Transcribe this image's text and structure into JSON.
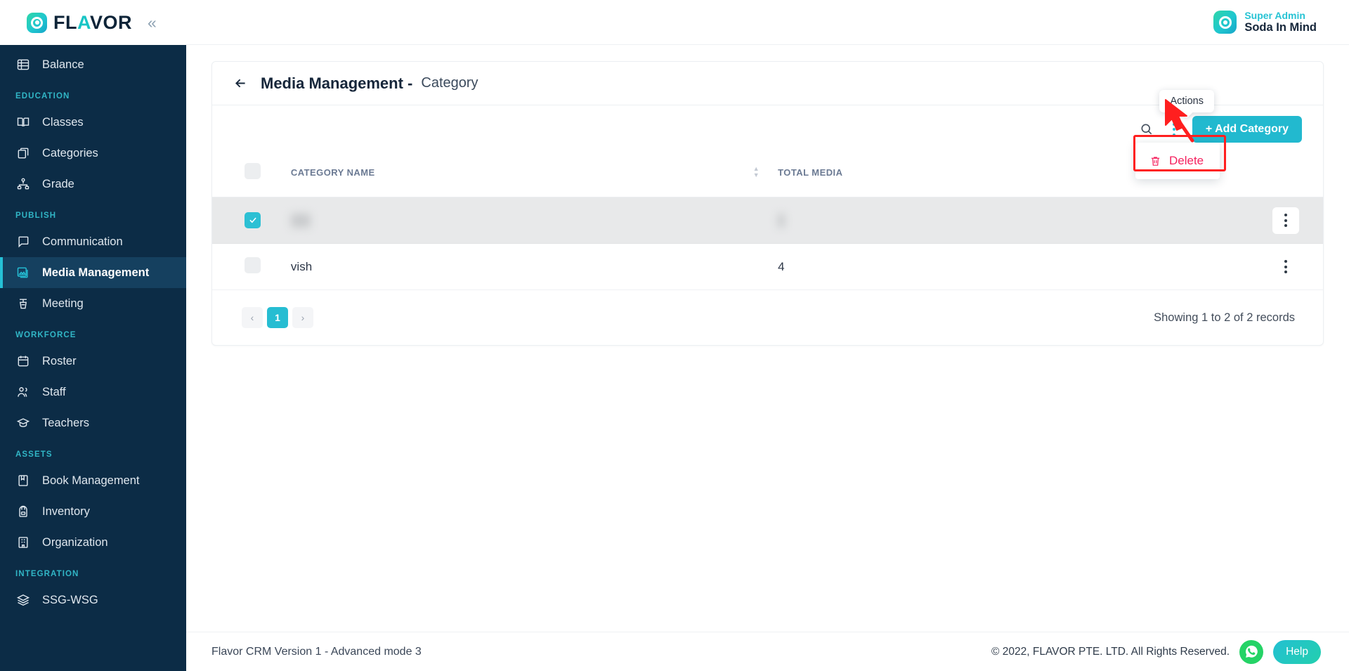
{
  "brand": {
    "name_main": "FL",
    "name_accent": "A",
    "name_rest": "VOR",
    "full": "FLAVOR",
    "collapse_glyph": "«"
  },
  "sidebar": {
    "groups": [
      {
        "label": "",
        "items": [
          {
            "label": "Balance",
            "icon": "balance-icon",
            "active": false
          }
        ]
      },
      {
        "label": "EDUCATION",
        "items": [
          {
            "label": "Classes",
            "icon": "book-icon",
            "active": false
          },
          {
            "label": "Categories",
            "icon": "categories-icon",
            "active": false
          },
          {
            "label": "Grade",
            "icon": "grade-icon",
            "active": false
          }
        ]
      },
      {
        "label": "PUBLISH",
        "items": [
          {
            "label": "Communication",
            "icon": "chat-icon",
            "active": false
          },
          {
            "label": "Media Management",
            "icon": "media-icon",
            "active": true
          },
          {
            "label": "Meeting",
            "icon": "podium-icon",
            "active": false
          }
        ]
      },
      {
        "label": "WORKFORCE",
        "items": [
          {
            "label": "Roster",
            "icon": "calendar-icon",
            "active": false
          },
          {
            "label": "Staff",
            "icon": "users-icon",
            "active": false
          },
          {
            "label": "Teachers",
            "icon": "graduation-cap-icon",
            "active": false
          }
        ]
      },
      {
        "label": "ASSETS",
        "items": [
          {
            "label": "Book Management",
            "icon": "book-closed-icon",
            "active": false
          },
          {
            "label": "Inventory",
            "icon": "backpack-icon",
            "active": false
          },
          {
            "label": "Organization",
            "icon": "building-icon",
            "active": false
          }
        ]
      },
      {
        "label": "INTEGRATION",
        "items": [
          {
            "label": "SSG-WSG",
            "icon": "layers-icon",
            "active": false
          }
        ]
      }
    ]
  },
  "topbar": {
    "user_role": "Super Admin",
    "user_name": "Soda In Mind",
    "avatar_icon": "circle-logo-avatar"
  },
  "page": {
    "back_icon": "back-arrow-icon",
    "title": "Media Management -",
    "subtitle": "Category"
  },
  "toolbar": {
    "search_icon": "search-icon",
    "actions_icon": "kebab-menu-icon",
    "actions_tooltip": "Actions",
    "add_button": "+ Add Category"
  },
  "actions_menu": {
    "items": [
      {
        "label": "Delete",
        "icon": "trash-icon",
        "color": "#f5225f"
      }
    ]
  },
  "table": {
    "columns": [
      {
        "key": "check",
        "label": ""
      },
      {
        "key": "name",
        "label": "CATEGORY NAME",
        "sortable": true
      },
      {
        "key": "total",
        "label": "TOTAL MEDIA",
        "sortable": true
      },
      {
        "key": "actions",
        "label": ""
      }
    ],
    "rows": [
      {
        "selected": true,
        "name": "      ",
        "total": "  ",
        "blurred": true,
        "kebab_hover": true
      },
      {
        "selected": false,
        "name": "vish",
        "total": "4",
        "blurred": false,
        "kebab_hover": false
      }
    ]
  },
  "pagination": {
    "prev_glyph": "‹",
    "next_glyph": "›",
    "pages": [
      "1"
    ],
    "active_page": "1",
    "records_text": "Showing 1 to 2 of 2 records"
  },
  "footer": {
    "version": "Flavor CRM Version 1 - Advanced mode 3",
    "copyright": "© 2022, FLAVOR PTE. LTD. All Rights Reserved.",
    "whatsapp_icon": "whatsapp-icon",
    "help_label": "Help"
  },
  "colors": {
    "sidebar_bg": "#0c2c46",
    "accent_teal": "#22b9cf",
    "section_label": "#31b6c6",
    "danger": "#f5225f",
    "annotation_red": "#ff1f1f"
  }
}
